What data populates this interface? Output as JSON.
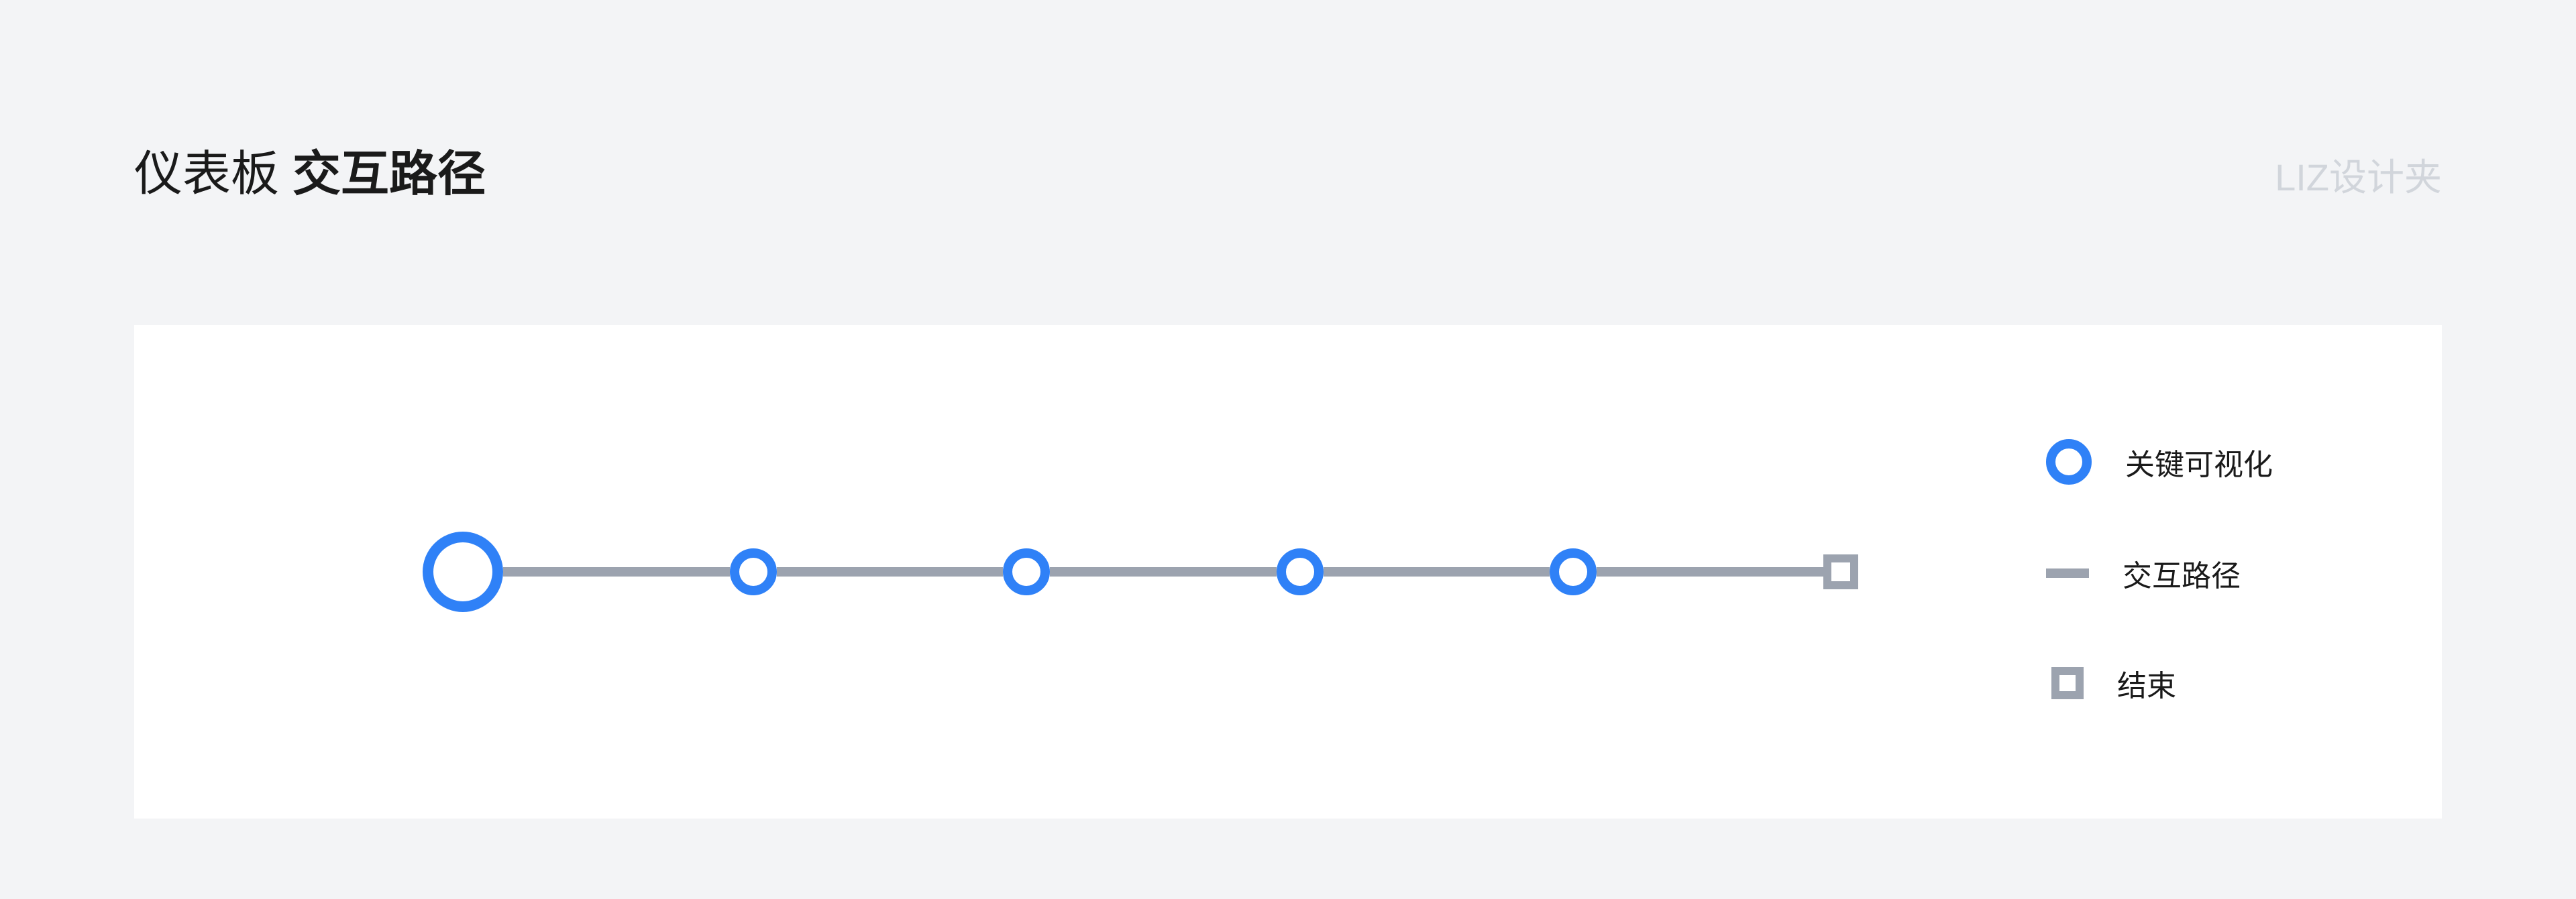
{
  "header": {
    "title_light": "仪表板",
    "title_bold": "交互路径",
    "watermark": "LIZ设计夹"
  },
  "legend": {
    "items": [
      {
        "type": "circle",
        "label": "关键可视化"
      },
      {
        "type": "line",
        "label": "交互路径"
      },
      {
        "type": "square",
        "label": "结束"
      }
    ]
  },
  "diagram": {
    "start_node": "start",
    "mid_nodes_count": 4,
    "end_node": "end"
  },
  "colors": {
    "accent": "#2f81f7",
    "neutral": "#9ca3af",
    "text": "#1a1a1a",
    "bg": "#f3f4f6",
    "card": "#ffffff"
  }
}
